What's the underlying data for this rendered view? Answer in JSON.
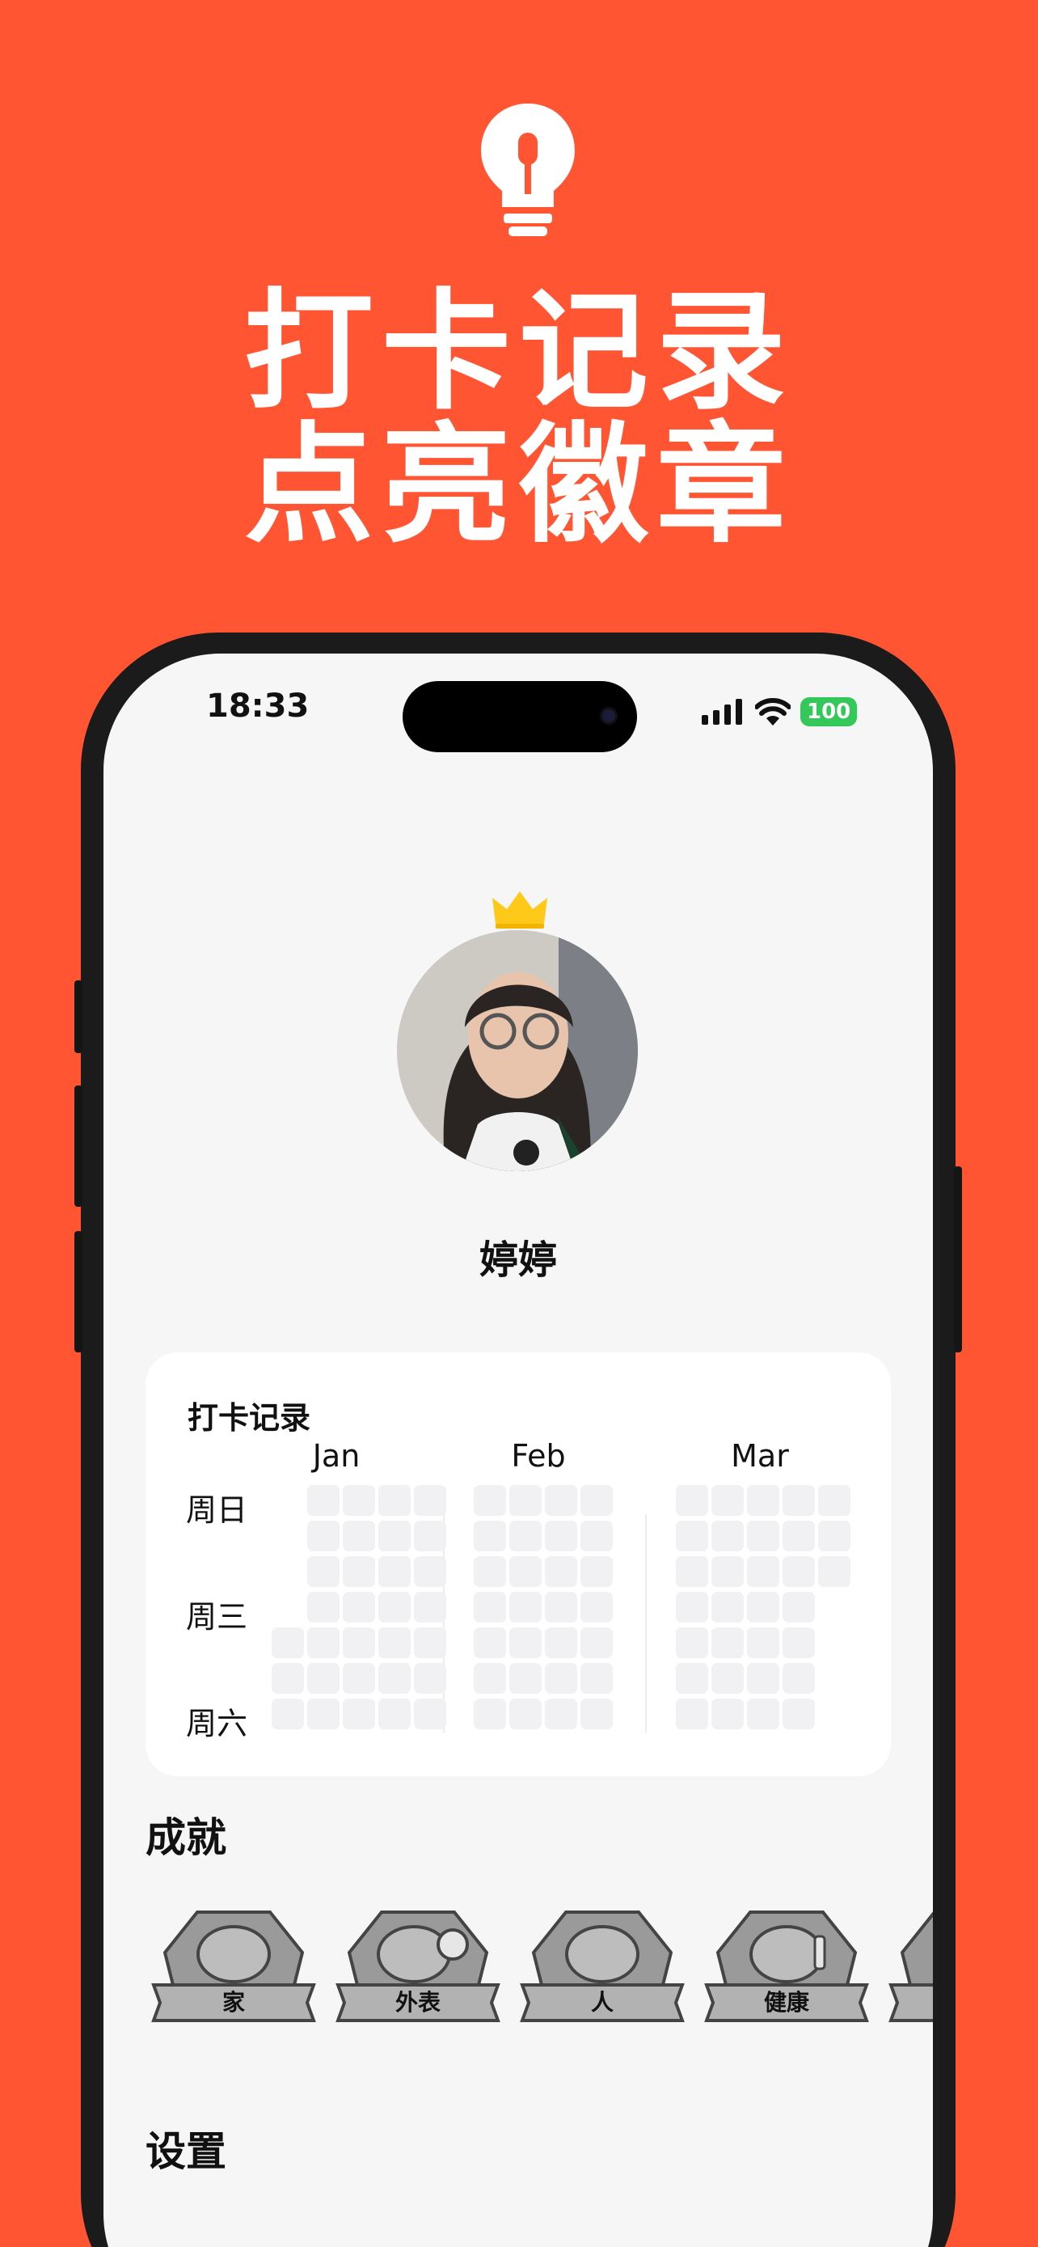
{
  "promo": {
    "headline_line1": "打卡记录",
    "headline_line2": "点亮徽章",
    "icon": "lightbulb-icon",
    "background_color": "#FF5533"
  },
  "status_bar": {
    "time": "18:33",
    "battery": "100",
    "icons": [
      "signal-icon",
      "wifi-icon",
      "battery-icon"
    ]
  },
  "profile": {
    "name": "婷婷",
    "badge_icon": "crown-icon"
  },
  "checkin": {
    "title": "打卡记录",
    "months": [
      "Jan",
      "Feb",
      "Mar"
    ],
    "weekdays": [
      "周日",
      "周三",
      "周六"
    ]
  },
  "achievements": {
    "title": "成就",
    "badges": [
      {
        "label": "家"
      },
      {
        "label": "外表"
      },
      {
        "label": "人"
      },
      {
        "label": "健康"
      }
    ]
  },
  "settings": {
    "title": "设置"
  }
}
